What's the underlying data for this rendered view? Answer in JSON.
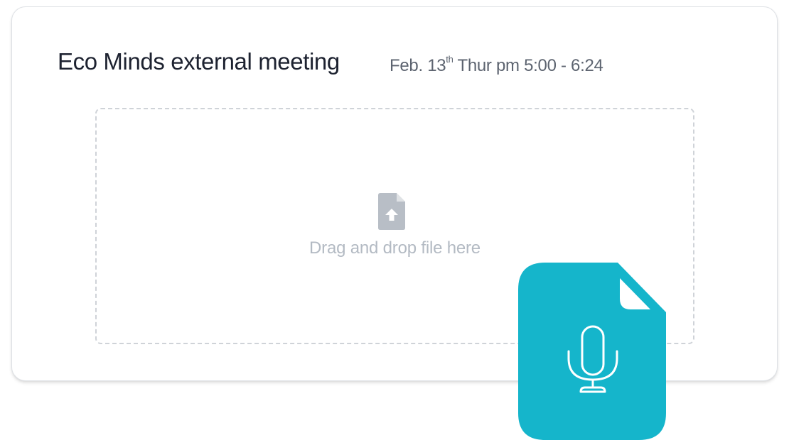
{
  "meeting": {
    "title": "Eco Minds external meeting",
    "date_prefix": "Feb. 13",
    "date_suffix": "th",
    "date_rest": " Thur pm 5:00 - 6:24"
  },
  "dropzone": {
    "text": "Drag and drop file here",
    "icon": "file-upload-icon"
  },
  "audio_file": {
    "icon": "audio-file-microphone-icon"
  },
  "colors": {
    "accent": "#15b5cb",
    "title_text": "#1d2230",
    "muted_text": "#b3bac3",
    "upload_icon": "#b8bec6"
  }
}
